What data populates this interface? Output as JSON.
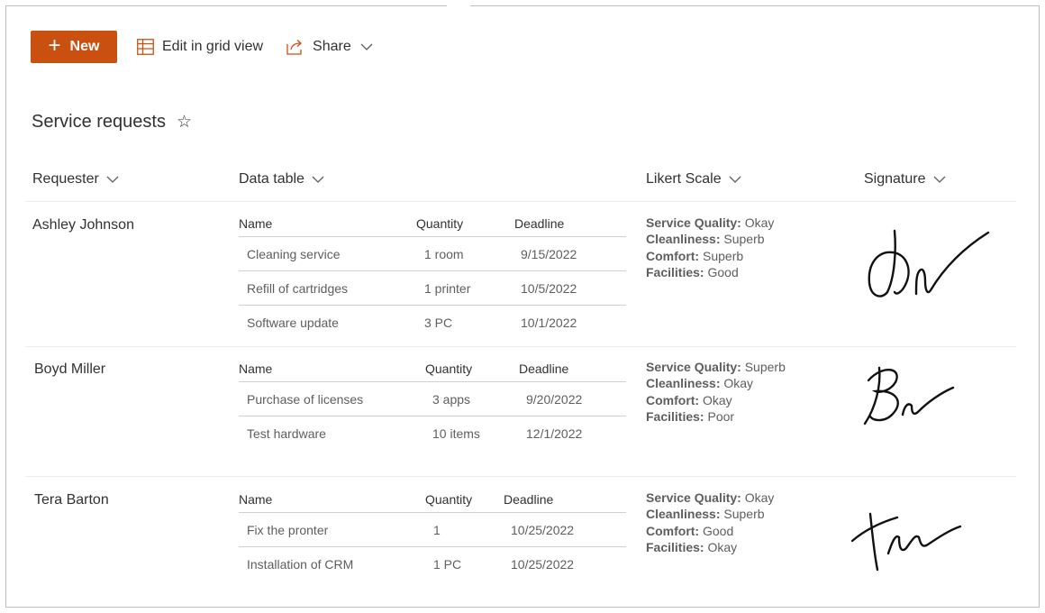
{
  "toolbar": {
    "new_label": "New",
    "grid_label": "Edit in grid view",
    "share_label": "Share"
  },
  "list": {
    "title": "Service requests",
    "columns": [
      "Requester",
      "Data table",
      "Likert Scale",
      "Signature"
    ]
  },
  "rows": [
    {
      "requester": "Ashley Johnson",
      "table_headers": [
        "Name",
        "Quantity",
        "Deadline"
      ],
      "items": [
        {
          "name": "Cleaning service",
          "quantity": "1 room",
          "deadline": "9/15/2022"
        },
        {
          "name": "Refill of cartridges",
          "quantity": "1 printer",
          "deadline": "10/5/2022"
        },
        {
          "name": "Software update",
          "quantity": "3 PC",
          "deadline": "10/1/2022"
        }
      ],
      "likert": [
        {
          "label": "Service Quality:",
          "value": "Okay"
        },
        {
          "label": "Cleanliness:",
          "value": "Superb"
        },
        {
          "label": "Comfort:",
          "value": "Superb"
        },
        {
          "label": "Facilities:",
          "value": "Good"
        }
      ]
    },
    {
      "requester": "Boyd Miller",
      "table_headers": [
        "Name",
        "Quantity",
        "Deadline"
      ],
      "items": [
        {
          "name": "Purchase of licenses",
          "quantity": "3 apps",
          "deadline": "9/20/2022"
        },
        {
          "name": "Test hardware",
          "quantity": "10 items",
          "deadline": "12/1/2022"
        }
      ],
      "likert": [
        {
          "label": "Service Quality:",
          "value": "Superb"
        },
        {
          "label": "Cleanliness:",
          "value": "Okay"
        },
        {
          "label": "Comfort:",
          "value": "Okay"
        },
        {
          "label": "Facilities:",
          "value": "Poor"
        }
      ]
    },
    {
      "requester": "Tera Barton",
      "table_headers": [
        "Name",
        "Quantity",
        "Deadline"
      ],
      "items": [
        {
          "name": "Fix the pronter",
          "quantity": "1",
          "deadline": "10/25/2022"
        },
        {
          "name": "Installation of CRM",
          "quantity": "1 PC",
          "deadline": "10/25/2022"
        }
      ],
      "likert": [
        {
          "label": "Service Quality:",
          "value": "Okay"
        },
        {
          "label": "Cleanliness:",
          "value": "Superb"
        },
        {
          "label": "Comfort:",
          "value": "Good"
        },
        {
          "label": "Facilities:",
          "value": "Okay"
        }
      ]
    }
  ],
  "colors": {
    "accent": "#ca5010",
    "text": "#323130",
    "subtle_text": "#605e5c",
    "divider": "#edebe9"
  }
}
